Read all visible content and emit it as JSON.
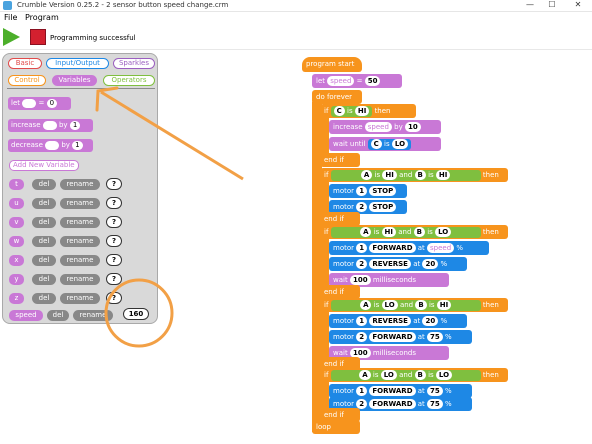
{
  "window": {
    "title": "Crumble Version 0.25.2 - 2 sensor button speed change.crm"
  },
  "menu": {
    "file": "File",
    "program": "Program"
  },
  "toolbar": {
    "status": "Programming successful"
  },
  "palette": {
    "tabs": [
      "Basic",
      "Input/Output",
      "Sparkles",
      "Control",
      "Variables",
      "Operators"
    ],
    "let_label": "let",
    "equals": "=",
    "let_value": "0",
    "increase_label": "increase",
    "by": "by",
    "increase_value": "1",
    "decrease_label": "decrease",
    "decrease_value": "1",
    "add_variable": "Add New Variable",
    "del": "del",
    "rename": "rename",
    "q": "?",
    "variables": [
      "t",
      "u",
      "v",
      "w",
      "x",
      "y",
      "z"
    ],
    "speed_var": "speed",
    "speed_value": "160"
  },
  "program": {
    "start": "program start",
    "let": "let",
    "speed": "speed",
    "eq": "=",
    "speed_init": "50",
    "do_forever": "do forever",
    "if": "if",
    "is": "is",
    "then": "then",
    "end_if": "end if",
    "and": "and",
    "hi": "HI",
    "lo": "LO",
    "c": "C",
    "a": "A",
    "b": "B",
    "increase": "increase",
    "by": "by",
    "inc_val": "10",
    "wait_until": "wait until",
    "motor": "motor",
    "stop": "STOP",
    "forward": "FORWARD",
    "reverse": "REVERSE",
    "at": "at",
    "pct": "%",
    "one": "1",
    "two": "2",
    "v20": "20",
    "v75": "75",
    "v100": "100",
    "wait": "wait",
    "ms": "milliseconds",
    "loop": "loop"
  },
  "colors": {
    "variables": "#c978d6",
    "control": "#f7941d",
    "motor": "#1e88e5",
    "condition": "#7fbf3f",
    "annotation": "#f2a046"
  }
}
